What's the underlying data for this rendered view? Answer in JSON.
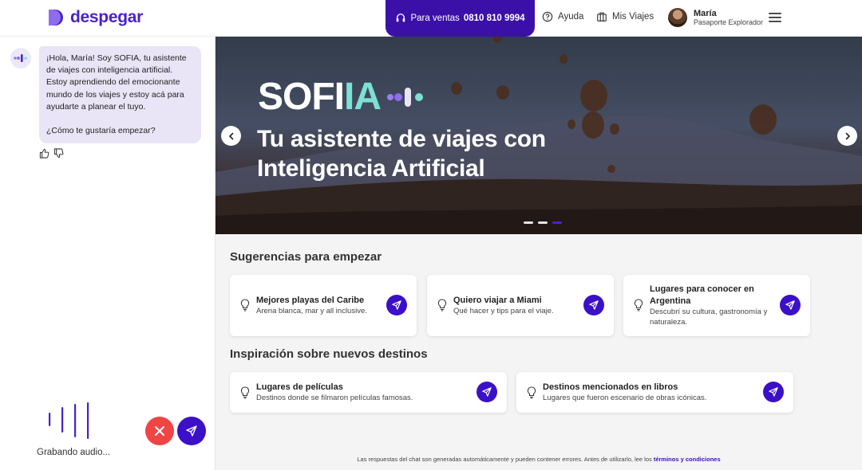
{
  "header": {
    "logo_text": "despegar",
    "sales_prefix": "Para ventas",
    "sales_phone": "0810 810 9994",
    "help_label": "Ayuda",
    "trips_label": "Mis Viajes",
    "user_name": "María",
    "user_subtitle": "Pasaporte Explorador"
  },
  "chat": {
    "message_lines": [
      "¡Hola, María! Soy SOFIA, tu asistente de viajes con inteligencia artificial. Estoy aprendiendo del emocionante mundo de los viajes y estoy acá para ayudarte a planear el tuyo.",
      "¿Cómo te gustaría empezar?"
    ],
    "recording_label": "Grabando audio..."
  },
  "hero": {
    "brand_main": "SOFI",
    "brand_accent": "IA",
    "title": "Tu asistente de viajes con Inteligencia Artificial",
    "slide_count": 3,
    "active_slide": 3
  },
  "suggestions": {
    "title": "Sugerencias para empezar",
    "cards": [
      {
        "title": "Mejores playas del Caribe",
        "desc": "Arena blanca, mar y all inclusive."
      },
      {
        "title": "Quiero viajar a Miami",
        "desc": "Qué hacer y tips para el viaje."
      },
      {
        "title": "Lugares para conocer en Argentina",
        "desc": "Descubrí su cultura, gastronomía y naturaleza."
      }
    ]
  },
  "inspiration": {
    "title": "Inspiración sobre nuevos destinos",
    "cards": [
      {
        "title": "Lugares de películas",
        "desc": "Destinos donde se filmaron películas famosas."
      },
      {
        "title": "Destinos mencionados en libros",
        "desc": "Lugares que fueron escenario de obras icónicas."
      }
    ]
  },
  "footer": {
    "note": "Las respuestas del chat son generadas automáticamente y pueden contener errores. Antes de utilizarlo, lee los ",
    "link": "términos y condiciones"
  },
  "colors": {
    "brand": "#4a21c9",
    "primary_button": "#3b10c8",
    "cancel_button": "#f04545",
    "chat_bubble": "#e9e4f6",
    "accent_ia": "#7ee0d4"
  }
}
